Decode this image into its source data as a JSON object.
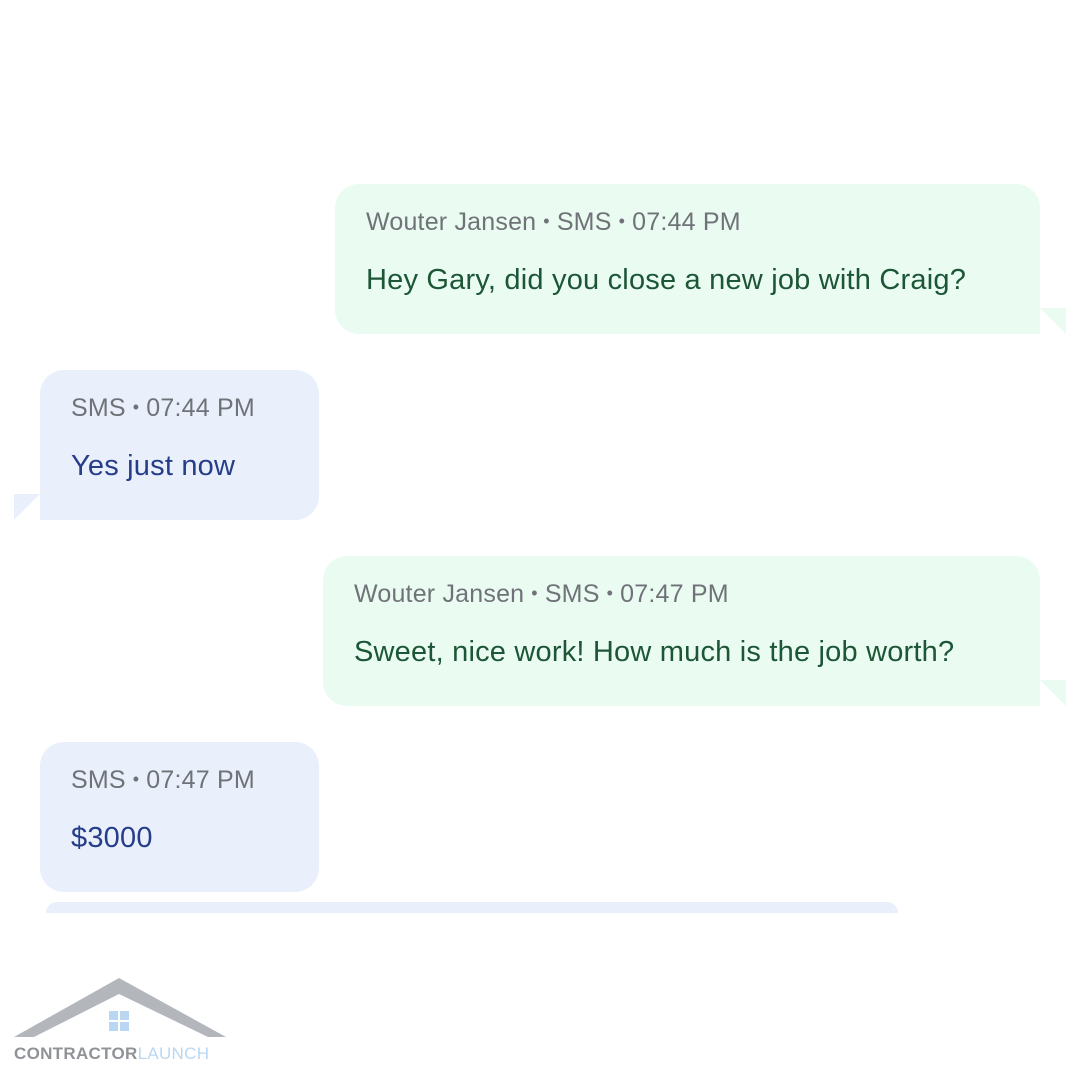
{
  "messages": [
    {
      "direction": "outgoing",
      "sender": "Wouter Jansen",
      "channel": "SMS",
      "time": "07:44 PM",
      "text": "Hey Gary, did you close a new job with Craig?"
    },
    {
      "direction": "incoming",
      "channel": "SMS",
      "time": "07:44 PM",
      "text": "Yes just now"
    },
    {
      "direction": "outgoing",
      "sender": "Wouter Jansen",
      "channel": "SMS",
      "time": "07:47 PM",
      "text": "Sweet, nice work! How much is the job worth?"
    },
    {
      "direction": "incoming",
      "channel": "SMS",
      "time": "07:47 PM",
      "text": "$3000"
    }
  ],
  "separator": "•",
  "logo": {
    "name_part1": "CONTRACTOR",
    "name_part2": "LAUNCH",
    "icon": "house-roof-icon"
  },
  "colors": {
    "outgoing_bubble": "#eafbf2",
    "outgoing_text": "#1c5636",
    "incoming_bubble": "#e9effb",
    "incoming_text": "#263d8a",
    "meta_text": "#6f7378"
  }
}
